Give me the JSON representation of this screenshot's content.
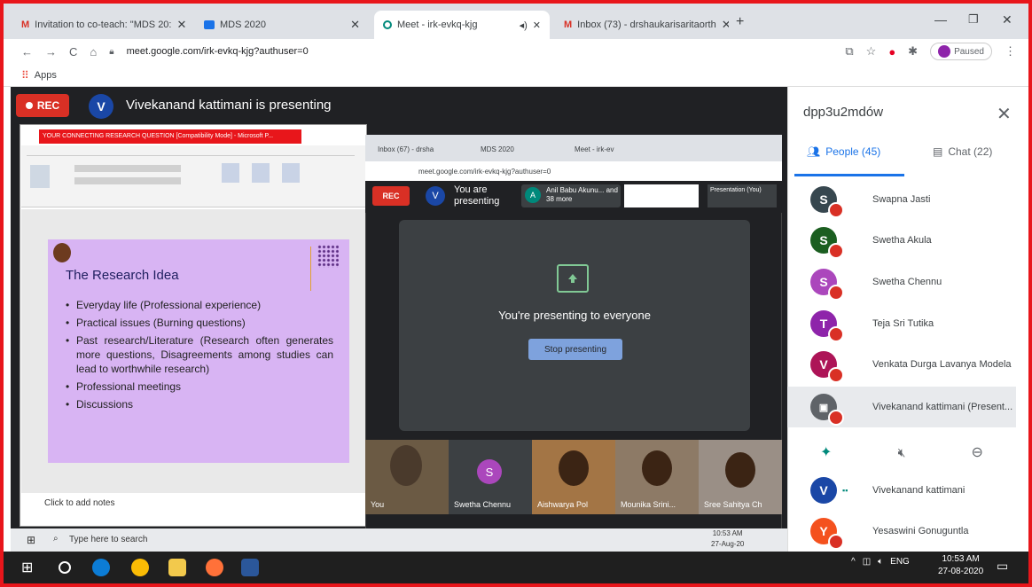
{
  "browser": {
    "tabs": [
      {
        "label": "Invitation to co-teach: \"MDS 20:",
        "icon": "gmail-icon",
        "color": "#d93025"
      },
      {
        "label": "MDS 2020",
        "icon": "classroom-icon",
        "color": "#1a73e8"
      },
      {
        "label": "Meet - irk-evkq-kjg",
        "icon": "meet-icon",
        "color": "#00897b"
      },
      {
        "label": "Inbox (73) - drshaukarisaritaorth",
        "icon": "gmail-icon",
        "color": "#d93025"
      }
    ],
    "url": "meet.google.com/irk-evkq-kjg?authuser=0",
    "profile_status": "Paused",
    "bookmarks_label": "Apps"
  },
  "meet": {
    "rec_label": "REC",
    "presenter_initial": "V",
    "presenter_label": "Vivekanand kattimani is presenting",
    "shared": {
      "window_title": "YOUR CONNECTING RESEARCH QUESTION [Compatibility Mode] - Microsoft P...",
      "slide_title": "The Research Idea",
      "bullets": [
        "Everyday life (Professional experience)",
        "Practical issues (Burning questions)",
        "Past research/Literature (Research often generates more questions, Disagreements among studies can lead to worthwhile research)",
        "Professional meetings",
        "Discussions"
      ],
      "notes": "Click to add notes",
      "taskbar_search": "Type here to search",
      "taskbar_time": "10:53 AM",
      "taskbar_date": "27-Aug-20",
      "nested": {
        "tab1": "Inbox (67) - drsha",
        "tab2": "MDS 2020",
        "tab3": "Meet - irk-ev",
        "url": "meet.google.com/irk-evkq-kjg?authuser=0",
        "rec": "REC",
        "you_presenting": "You are presenting",
        "others": "Anil Babu Akunu... and 38 more",
        "others_initial": "A",
        "presentation_tag": "Presentation (You)",
        "presenting_text": "You're presenting to everyone",
        "stop_label": "Stop presenting",
        "tiles": [
          "You",
          "Swetha Chennu",
          "Aishwarya Pol",
          "Mounika Srini...",
          "Sree Sahitya Ch"
        ]
      }
    },
    "sidebar": {
      "meeting_code": "dpp3u2mdów",
      "people_tab": "People (45)",
      "chat_tab": "Chat (22)",
      "participants": [
        {
          "initial": "S",
          "name": "Swapna Jasti",
          "color": "#37474f"
        },
        {
          "initial": "S",
          "name": "Swetha Akula",
          "color": "#1b5e20"
        },
        {
          "initial": "S",
          "name": "Swetha Chennu",
          "color": "#ab47bc"
        },
        {
          "initial": "T",
          "name": "Teja Sri Tutika",
          "color": "#8e24aa"
        },
        {
          "initial": "V",
          "name": "Venkata Durga Lavanya Modela",
          "color": "#ad1457"
        },
        {
          "initial": "",
          "name": "Vivekanand kattimani (Present...",
          "color": "#5f6368"
        }
      ],
      "more_participants": [
        {
          "initial": "V",
          "name": "Vivekanand kattimani",
          "color": "#1a47a6"
        },
        {
          "initial": "Y",
          "name": "Yesaswini Gonuguntla",
          "color": "#f4511e"
        }
      ]
    }
  },
  "os": {
    "lang": "ENG",
    "time": "10:53 AM",
    "date": "27-08-2020"
  }
}
